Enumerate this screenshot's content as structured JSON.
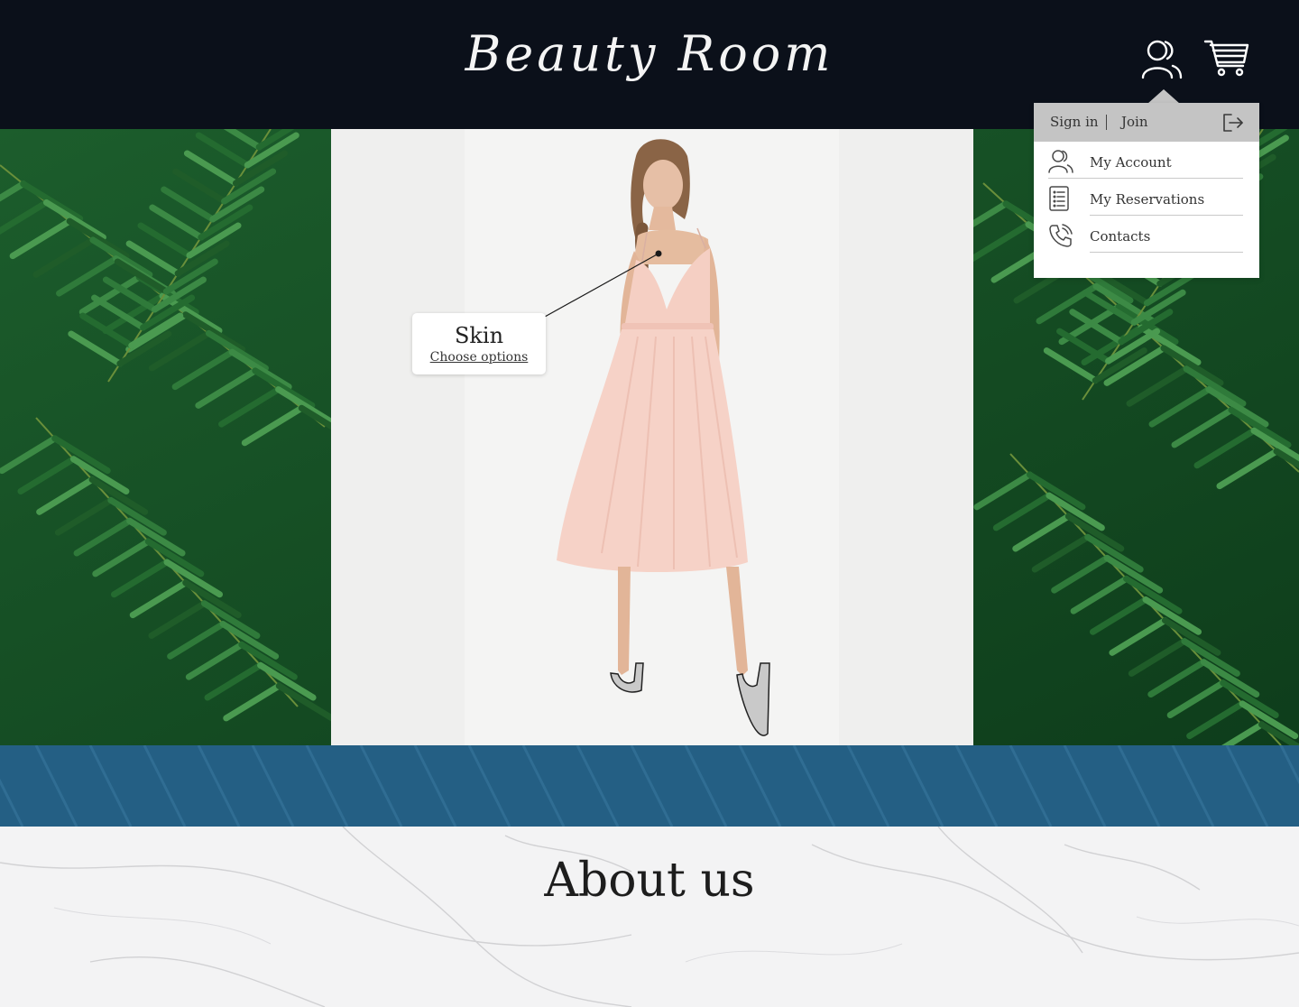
{
  "header": {
    "brand": "Beauty Room",
    "icons": [
      "users-icon",
      "cart-icon"
    ]
  },
  "hotspot": {
    "title": "Skin",
    "link": "Choose options"
  },
  "account_menu": {
    "sign_in": "Sign in",
    "join": "Join",
    "items": [
      {
        "label": "My Account",
        "icon": "users-icon"
      },
      {
        "label": "My Reservations",
        "icon": "list-icon"
      },
      {
        "label": "Contacts",
        "icon": "phone-icon"
      }
    ]
  },
  "about": {
    "title": "About us"
  },
  "colors": {
    "header_bg": "#0b101a",
    "band_bg": "#245f84",
    "dress": "#f6cfc4",
    "dropdown_top": "#c4c4c4"
  }
}
